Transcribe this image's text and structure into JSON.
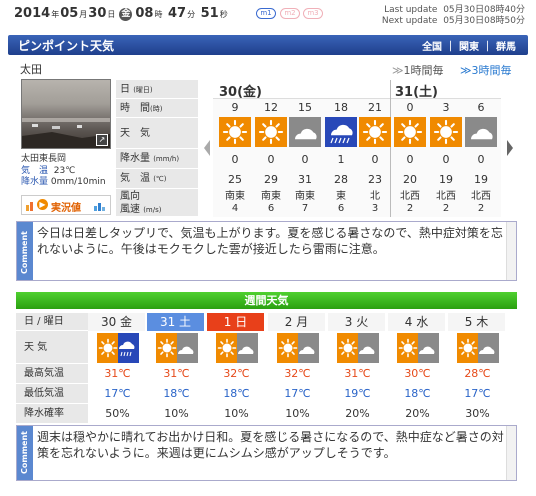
{
  "header": {
    "year": "2014",
    "year_unit": "年",
    "month": "05",
    "month_unit": "月",
    "day": "30",
    "day_unit": "日",
    "weekday": "金",
    "hour": "08",
    "hour_unit": "時",
    "minute": "47",
    "minute_unit": "分",
    "second": "51",
    "second_unit": "秒",
    "pills": [
      "m1",
      "m2",
      "m3"
    ],
    "last_update_label": "Last update",
    "last_update_value": "05月30日08時40分",
    "next_update_label": "Next update",
    "next_update_value": "05月30日08時50分"
  },
  "titlebar": {
    "title": "ピンポイント天気",
    "breadcrumb": [
      "全国",
      "関東",
      "群馬"
    ],
    "separator": "｜"
  },
  "area": {
    "name": "太田"
  },
  "tabs": {
    "hourly1": "1時間毎",
    "hourly3": "3時間毎"
  },
  "camera": {
    "station": "太田東長岡",
    "temp_label": "気　温",
    "temp_value": "23℃",
    "rain_label": "降水量",
    "rain_value": "0mm/10min",
    "jikkyo": "実況値"
  },
  "hourly": {
    "labels": {
      "day": "日",
      "day_small": "(曜日)",
      "time": "時　間",
      "time_small": "(時)",
      "weather": "天　気",
      "precip": "降水量",
      "precip_small": "(mm/h)",
      "temp": "気　温",
      "temp_small": "(℃)",
      "wind": "風向",
      "wind_speed": "風速",
      "wind_small": "(m/s)"
    },
    "day1": "30(金)",
    "day2": "31(土)",
    "hours": [
      "9",
      "12",
      "15",
      "18",
      "21",
      "0",
      "3",
      "6"
    ],
    "weather_icons": [
      "sun-icon",
      "sun-icon",
      "cloud-icon",
      "rain-cloud-icon",
      "sun-icon",
      "sun-icon",
      "sun-icon",
      "cloud-icon"
    ],
    "precip": [
      "0",
      "0",
      "0",
      "1",
      "0",
      "0",
      "0",
      "0"
    ],
    "temp": [
      "25",
      "29",
      "31",
      "28",
      "23",
      "20",
      "19",
      "19"
    ],
    "wind_dir": [
      "南東",
      "南東",
      "南東",
      "東",
      "北",
      "北西",
      "北西",
      "北西"
    ],
    "wind_speed": [
      "4",
      "6",
      "7",
      "6",
      "3",
      "2",
      "2",
      "2"
    ]
  },
  "comment1": {
    "side_label": "Comment",
    "text": "今日は日差しタップリで、気温も上がります。夏を感じる暑さなので、熱中症対策を忘れないように。午後はモクモクした雲が接近したら雷雨に注意。"
  },
  "weekly": {
    "title": "週間天気",
    "labels": {
      "day": "日 / 曜日",
      "weather": "天 気",
      "max": "最高気温",
      "min": "最低気温",
      "precip": "降水確率"
    },
    "days": [
      {
        "date": "30",
        "wd": "金",
        "max": "31℃",
        "min": "17℃",
        "precip": "50%"
      },
      {
        "date": "31",
        "wd": "土",
        "max": "31℃",
        "min": "18℃",
        "precip": "10%"
      },
      {
        "date": "1",
        "wd": "日",
        "max": "32℃",
        "min": "18℃",
        "precip": "10%"
      },
      {
        "date": "2",
        "wd": "月",
        "max": "32℃",
        "min": "17℃",
        "precip": "10%"
      },
      {
        "date": "3",
        "wd": "火",
        "max": "31℃",
        "min": "19℃",
        "precip": "20%"
      },
      {
        "date": "4",
        "wd": "水",
        "max": "30℃",
        "min": "18℃",
        "precip": "20%"
      },
      {
        "date": "5",
        "wd": "木",
        "max": "28℃",
        "min": "17℃",
        "precip": "30%"
      }
    ],
    "weather_icons": [
      "sun-rain-icon",
      "sun-cloud-icon",
      "sun-cloud-icon",
      "sun-cloud-icon",
      "sun-cloud-icon",
      "sun-cloud-icon",
      "sun-cloud-icon"
    ]
  },
  "comment2": {
    "side_label": "Comment",
    "text": "週末は穏やかに晴れてお出かけ日和。夏を感じる暑さになるので、熱中症など暑さの対策を忘れないように。来週は更にムシムシ感がアップしそうです。"
  },
  "colors": {
    "nav_blue": "#1f3f8c",
    "green": "#2aa010",
    "sun": "#f08a00",
    "hot_red": "#e64a19",
    "cool_blue": "#2a64c8",
    "saturday_bg": "#5b8ee0",
    "sunday_bg": "#e8401a"
  }
}
